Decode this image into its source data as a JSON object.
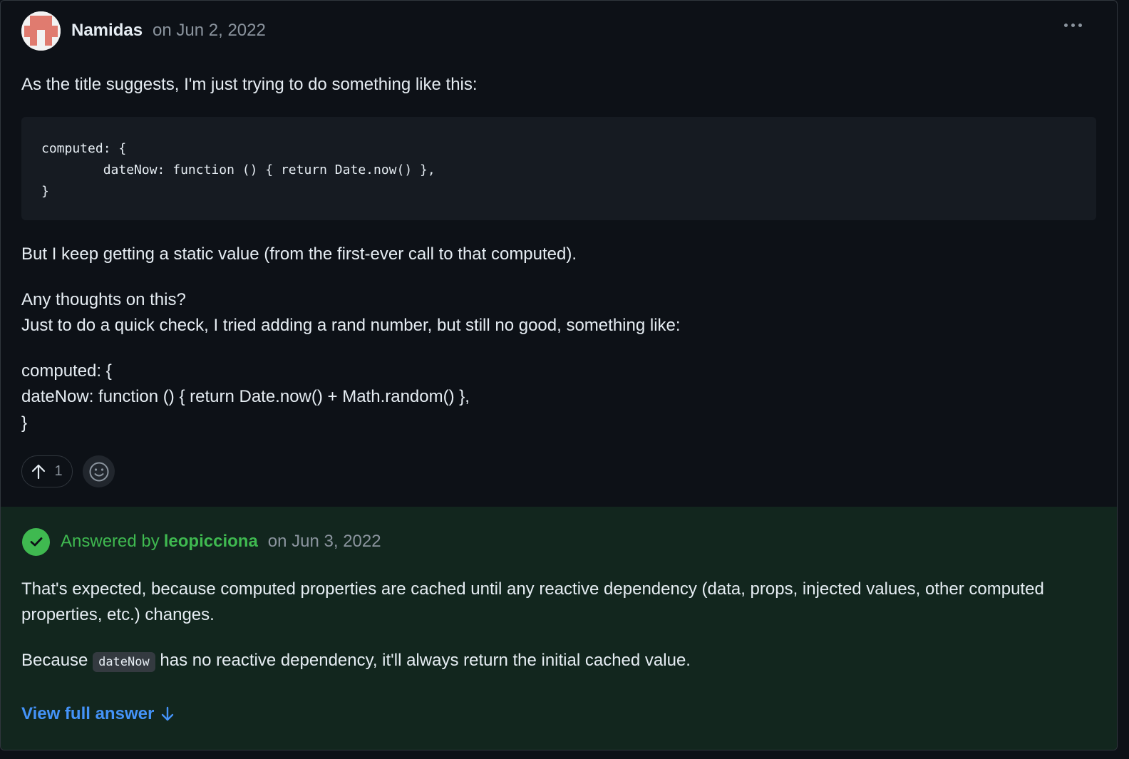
{
  "post": {
    "author": "Namidas",
    "date": "on Jun 2, 2022",
    "para1": "As the title suggests, I'm just trying to do something like this:",
    "code": "computed: {\n        dateNow: function () { return Date.now() },\n}",
    "para2": "But I keep getting a static value (from the first-ever call to that computed).",
    "para3_line1": "Any thoughts on this?",
    "para3_line2": "Just to do a quick check, I tried adding a rand number, but still no good, something like:",
    "para4_line1": "computed: {",
    "para4_line2": "dateNow: function () { return Date.now() + Math.random() },",
    "para4_line3": "}",
    "upvote_count": "1"
  },
  "answer": {
    "answered_label": "Answered by",
    "answerer": "leopicciona",
    "date": "on Jun 3, 2022",
    "para1": "That's expected, because computed properties are cached until any reactive dependency (data, props, injected values, other computed properties, etc.) changes.",
    "para2_before": "Because ",
    "para2_code": "dateNow",
    "para2_after": " has no reactive dependency, it'll always return the initial cached value.",
    "view_full": "View full answer"
  },
  "colors": {
    "accent_green": "#3fb950",
    "link_blue": "#4493f8",
    "background": "#0d1117",
    "answer_background": "#12261e"
  },
  "icons": [
    "kebab-icon",
    "arrow-up-icon",
    "smiley-icon",
    "check-icon",
    "arrow-down-icon"
  ]
}
